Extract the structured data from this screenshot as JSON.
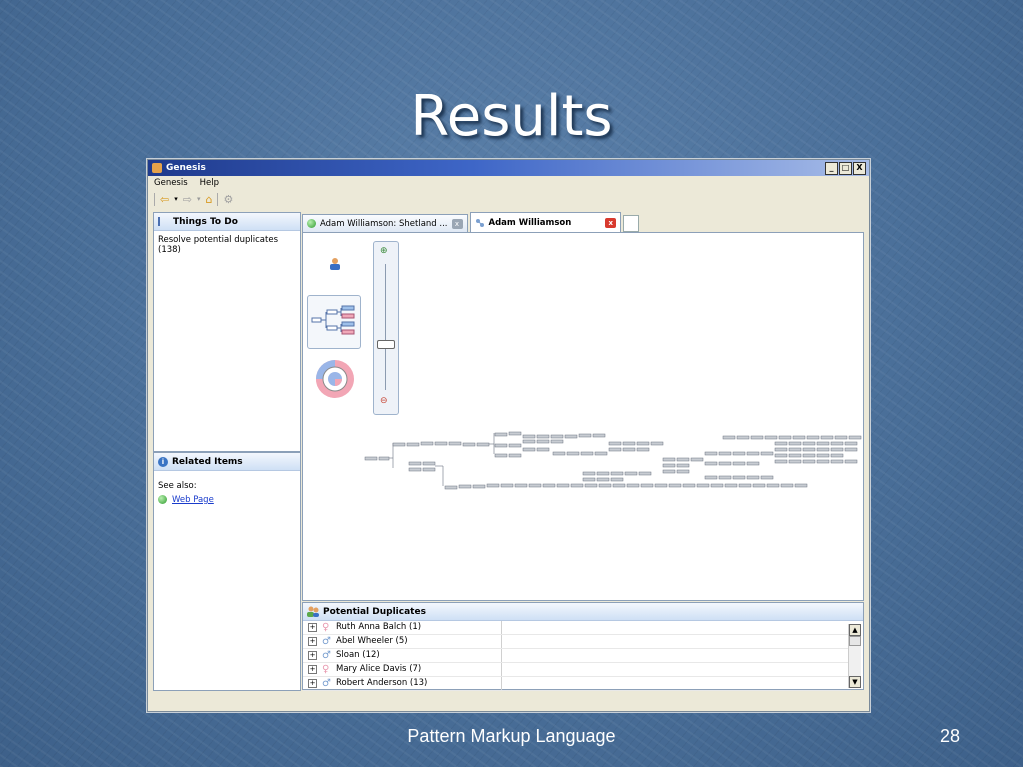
{
  "slide": {
    "title": "Results",
    "footer": "Pattern Markup Language",
    "page_number": "28"
  },
  "window": {
    "title": "Genesis",
    "controls": {
      "minimize": "_",
      "maximize": "□",
      "close": "X"
    },
    "menu": [
      "Genesis",
      "Help"
    ]
  },
  "left_panel": {
    "todo": {
      "title": "Things To Do",
      "item": "Resolve potential duplicates (138)"
    },
    "related": {
      "title": "Related Items",
      "see_also": "See also:",
      "link": "Web Page"
    }
  },
  "tabs": [
    {
      "label": "Adam Williamson: Shetland ...",
      "close": "x"
    },
    {
      "label": "Adam Williamson",
      "close": "x"
    }
  ],
  "duplicates": {
    "title": "Potential Duplicates",
    "rows": [
      {
        "name": "Ruth Anna Balch (1)",
        "gender": "female"
      },
      {
        "name": "Abel Wheeler (5)",
        "gender": "male"
      },
      {
        "name": "Sloan (12)",
        "gender": "male"
      },
      {
        "name": "Mary Alice Davis (7)",
        "gender": "female"
      },
      {
        "name": "Robert Anderson (13)",
        "gender": "male"
      }
    ]
  },
  "colors": {
    "female": "#e89ab0",
    "male": "#7a9fd0",
    "accent": "#3e66c7"
  }
}
